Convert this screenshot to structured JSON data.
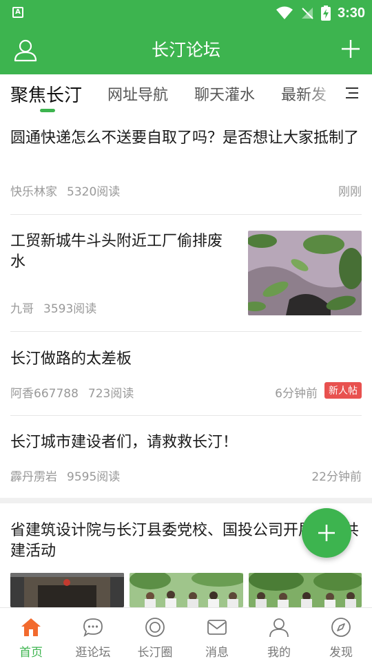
{
  "status_bar": {
    "time": "3:30",
    "left_icon_letter": "A"
  },
  "header": {
    "title": "长汀论坛"
  },
  "tabs": [
    {
      "label": "聚焦长汀",
      "active": true
    },
    {
      "label": "网址导航",
      "active": false
    },
    {
      "label": "聊天灌水",
      "active": false
    },
    {
      "label": "最新发",
      "active": false
    }
  ],
  "posts": [
    {
      "title": "圆通快递怎么不送要自取了吗？是否想让大家抵制了",
      "author": "快乐林家",
      "reads": "5320阅读",
      "time": "刚刚"
    },
    {
      "title": "工贸新城牛斗头附近工厂偷排废水",
      "author": "九哥",
      "reads": "3593阅读",
      "time": ""
    },
    {
      "title": "长汀做路的太差板",
      "author": "阿香667788",
      "reads": "723阅读",
      "time": "6分钟前",
      "badge": "新人帖"
    },
    {
      "title": "长汀城市建设者们，请救救长汀！",
      "author": "霹丹雳岩",
      "reads": "9595阅读",
      "time": "22分钟前"
    },
    {
      "title": "省建筑设计院与长汀县委党校、国投公司开展党建共建活动",
      "author": "",
      "reads": "",
      "time": ""
    }
  ],
  "bottom_nav": [
    {
      "label": "首页",
      "icon": "home-icon",
      "active": true
    },
    {
      "label": "逛论坛",
      "icon": "chat-bubble-icon",
      "active": false
    },
    {
      "label": "长汀圈",
      "icon": "circle-icon",
      "active": false
    },
    {
      "label": "消息",
      "icon": "mail-icon",
      "active": false
    },
    {
      "label": "我的",
      "icon": "profile-icon",
      "active": false
    },
    {
      "label": "发现",
      "icon": "compass-icon",
      "active": false
    }
  ],
  "colors": {
    "brand": "#3db44f",
    "badge": "#e8514f",
    "meta": "#999999"
  }
}
